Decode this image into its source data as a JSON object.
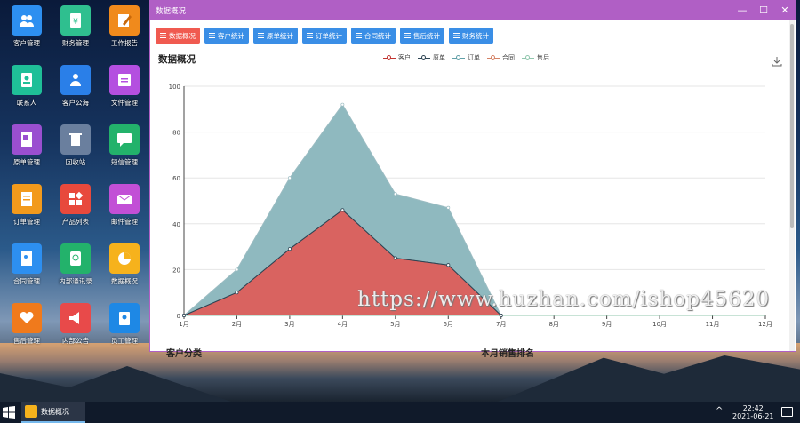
{
  "desktop": {
    "icons": [
      {
        "label": "客户管理",
        "icon": "users-icon",
        "color": "#2d8ff0"
      },
      {
        "label": "财务管理",
        "icon": "yen-icon",
        "color": "#2fbf8f"
      },
      {
        "label": "工作报告",
        "icon": "edit-icon",
        "color": "#f08a1c"
      },
      {
        "label": "联系人",
        "icon": "contact-icon",
        "color": "#1fbf98"
      },
      {
        "label": "客户公海",
        "icon": "group-icon",
        "color": "#2a7fe8"
      },
      {
        "label": "文件管理",
        "icon": "folder-icon",
        "color": "#b44fe0"
      },
      {
        "label": "原单管理",
        "icon": "book-icon",
        "color": "#9a4fd0"
      },
      {
        "label": "回收站",
        "icon": "trash-icon",
        "color": "#6a7f9e"
      },
      {
        "label": "短信管理",
        "icon": "message-icon",
        "color": "#23b26b"
      },
      {
        "label": "订单管理",
        "icon": "order-icon",
        "color": "#f29a1c"
      },
      {
        "label": "产品列表",
        "icon": "product-icon",
        "color": "#e8493c"
      },
      {
        "label": "邮件管理",
        "icon": "mail-icon",
        "color": "#c24fd6"
      },
      {
        "label": "合同管理",
        "icon": "contract-icon",
        "color": "#2d8ff0"
      },
      {
        "label": "内部通讯录",
        "icon": "addressbook-icon",
        "color": "#23b26b"
      },
      {
        "label": "数据概况",
        "icon": "piechart-icon",
        "color": "#f6b21c"
      },
      {
        "label": "售后管理",
        "icon": "heart-hand-icon",
        "color": "#f07a1c"
      },
      {
        "label": "内部公告",
        "icon": "megaphone-icon",
        "color": "#e84a4a"
      },
      {
        "label": "员工管理",
        "icon": "badge-icon",
        "color": "#1e88e5"
      }
    ]
  },
  "window": {
    "title": "数据概况",
    "controls": {
      "minimize": "—",
      "maximize": "☐",
      "close": "✕"
    },
    "tabs": [
      {
        "label": "数据概况",
        "active": true
      },
      {
        "label": "客户统计",
        "active": false
      },
      {
        "label": "原单统计",
        "active": false
      },
      {
        "label": "订单统计",
        "active": false
      },
      {
        "label": "合同统计",
        "active": false
      },
      {
        "label": "售后统计",
        "active": false
      },
      {
        "label": "财务统计",
        "active": false
      }
    ],
    "chart_heading": "数据概况",
    "section_left": "客户分类",
    "section_right": "本月销售排名"
  },
  "chart_data": {
    "type": "area",
    "title": "数据概况",
    "categories": [
      "1月",
      "2月",
      "3月",
      "4月",
      "5月",
      "6月",
      "7月",
      "8月",
      "9月",
      "10月",
      "11月",
      "12月"
    ],
    "ylim": [
      0,
      100
    ],
    "yticks": [
      0,
      20,
      40,
      60,
      80,
      100
    ],
    "grid": true,
    "legend_position": "top",
    "series": [
      {
        "name": "客户",
        "color": "#c23531",
        "values": [
          0,
          10,
          29,
          46,
          25,
          22,
          0,
          0,
          0,
          0,
          0,
          0
        ]
      },
      {
        "name": "原单",
        "color": "#2f4554",
        "values": [
          0,
          10,
          29,
          46,
          25,
          22,
          0,
          0,
          0,
          0,
          0,
          0
        ]
      },
      {
        "name": "订单",
        "color": "#61a0a8",
        "values": [
          0,
          20,
          60,
          92,
          53,
          47,
          0,
          0,
          0,
          0,
          0,
          0
        ]
      },
      {
        "name": "合同",
        "color": "#d48265",
        "values": [
          0,
          0,
          0,
          0,
          0,
          0,
          0,
          0,
          0,
          0,
          0,
          0
        ]
      },
      {
        "name": "售后",
        "color": "#91c7ae",
        "values": [
          0,
          0,
          0,
          0,
          0,
          0,
          0,
          0,
          0,
          0,
          0,
          0
        ]
      }
    ]
  },
  "watermark": "https://www.huzhan.com/ishop45620",
  "taskbar": {
    "app_label": "数据概况",
    "time": "22:42",
    "date": "2021-06-21",
    "tray_chevron": "^"
  }
}
